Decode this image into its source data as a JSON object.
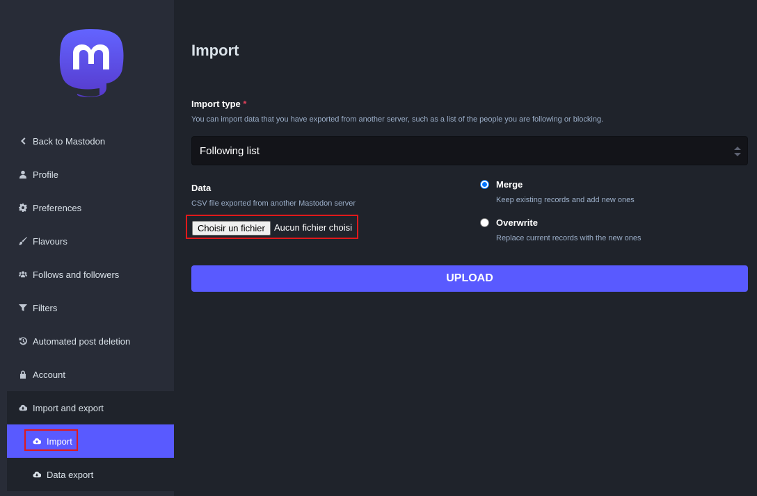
{
  "sidebar": {
    "logo": "mastodon-logo",
    "items": [
      {
        "label": "Back to Mastodon",
        "icon": "chevron-left-icon"
      },
      {
        "label": "Profile",
        "icon": "user-icon"
      },
      {
        "label": "Preferences",
        "icon": "cog-icon"
      },
      {
        "label": "Flavours",
        "icon": "paint-brush-icon"
      },
      {
        "label": "Follows and followers",
        "icon": "users-icon"
      },
      {
        "label": "Filters",
        "icon": "filter-icon"
      },
      {
        "label": "Automated post deletion",
        "icon": "history-icon"
      },
      {
        "label": "Account",
        "icon": "lock-icon"
      },
      {
        "label": "Import and export",
        "icon": "cloud-download-icon"
      }
    ],
    "sub_items": [
      {
        "label": "Import",
        "icon": "cloud-upload-icon",
        "active": true
      },
      {
        "label": "Data export",
        "icon": "cloud-download-icon",
        "active": false
      }
    ]
  },
  "main": {
    "title": "Import",
    "import_type": {
      "label": "Import type",
      "required_mark": "*",
      "hint": "You can import data that you have exported from another server, such as a list of the people you are following or blocking.",
      "selected": "Following list"
    },
    "data": {
      "label": "Data",
      "hint": "CSV file exported from another Mastodon server",
      "file_button": "Choisir un fichier",
      "file_status": "Aucun fichier choisi"
    },
    "mode": {
      "options": [
        {
          "label": "Merge",
          "hint": "Keep existing records and add new ones",
          "checked": true
        },
        {
          "label": "Overwrite",
          "hint": "Replace current records with the new ones",
          "checked": false
        }
      ]
    },
    "upload_label": "UPLOAD"
  },
  "colors": {
    "background": "#1f232b",
    "sidebar": "#282c37",
    "accent": "#595aff",
    "highlight_border": "#e0191b"
  }
}
